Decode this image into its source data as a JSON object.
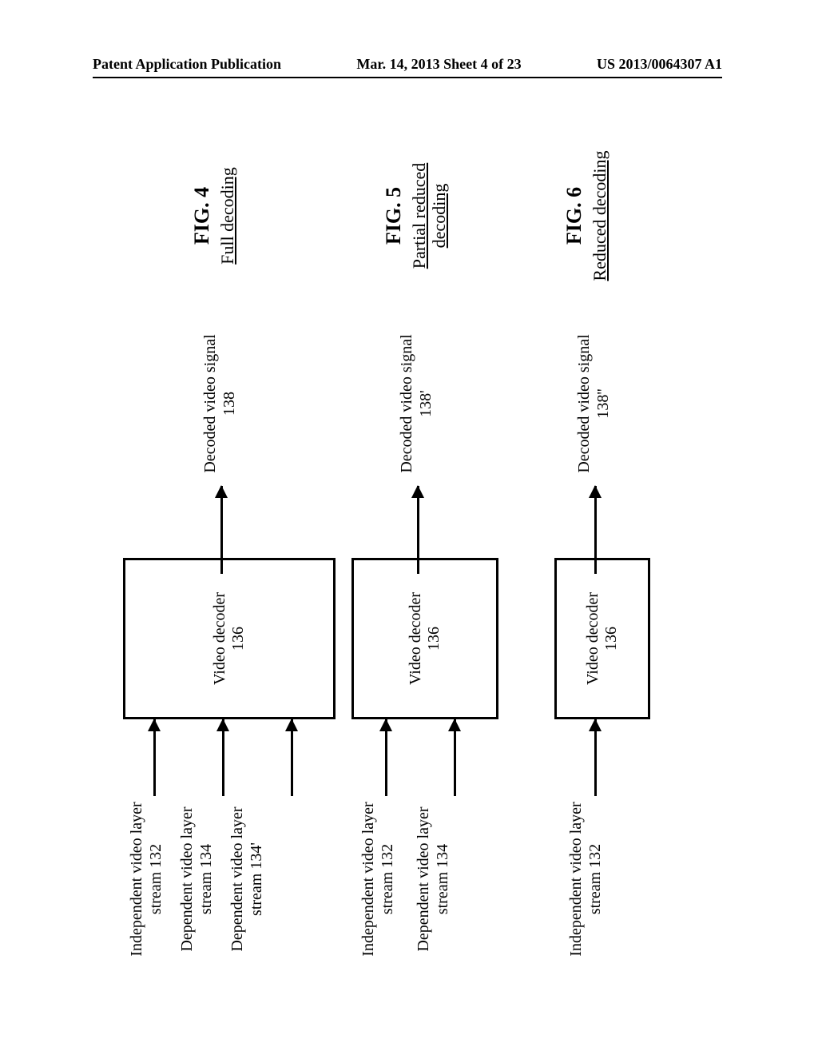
{
  "header": {
    "left": "Patent Application Publication",
    "mid": "Mar. 14, 2013  Sheet 4 of 23",
    "right": "US 2013/0064307 A1"
  },
  "fig4": {
    "in1": "Independent video layer stream 132",
    "in2": "Dependent video layer stream 134",
    "in3": "Dependent video layer stream 134'",
    "decoder_l1": "Video decoder",
    "decoder_l2": "136",
    "out": "Decoded video signal 138",
    "num": "FIG. 4",
    "sub": "Full decoding"
  },
  "fig5": {
    "in1": "Independent video layer stream 132",
    "in2": "Dependent video layer stream 134",
    "decoder_l1": "Video decoder",
    "decoder_l2": "136",
    "out": "Decoded video signal 138'",
    "num": "FIG. 5",
    "sub": "Partial reduced decoding"
  },
  "fig6": {
    "in1": "Independent video layer stream 132",
    "decoder_l1": "Video decoder",
    "decoder_l2": "136",
    "out": "Decoded video signal 138''",
    "num": "FIG. 6",
    "sub": "Reduced decoding"
  }
}
